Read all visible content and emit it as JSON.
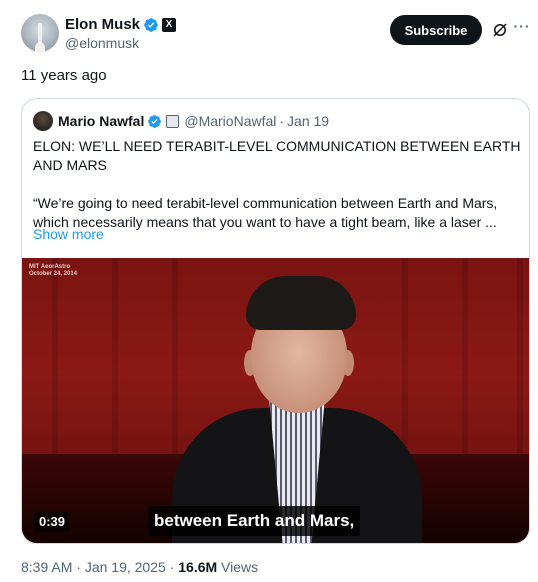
{
  "author": {
    "name": "Elon Musk",
    "handle": "@elonmusk",
    "badge_color": "#1d9bf0",
    "affiliation_badge": "X"
  },
  "actions": {
    "subscribe_label": "Subscribe",
    "grok_icon": "grok-icon",
    "more_icon": "more-icon",
    "more_glyph": "···"
  },
  "tweet": {
    "text": "11 years ago"
  },
  "quoted": {
    "name": "Mario Nawfal",
    "handle": "@MarioNawfal",
    "separator": "·",
    "date": "Jan 19",
    "title": "ELON: WE’LL NEED TERABIT-LEVEL COMMUNICATION BETWEEN EARTH AND MARS",
    "body": "“We’re going to need terabit-level communication between Earth and Mars, which necessarily means that you want to have a tight beam, like a laser ...",
    "show_more": "Show more",
    "video": {
      "watermark_line1": "MIT AeorAstro",
      "watermark_line2": "October 24, 2014",
      "duration": "0:39",
      "caption": "between Earth and Mars,"
    }
  },
  "meta": {
    "time": "8:39 AM",
    "separator1": " · ",
    "date": "Jan 19, 2025",
    "separator2": " · ",
    "views_count": "16.6M",
    "views_label": " Views"
  }
}
